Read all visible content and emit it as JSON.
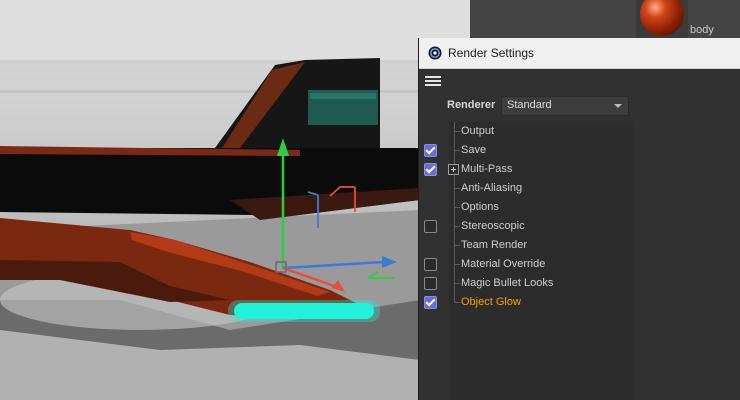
{
  "material_manager": {
    "material_name": "body"
  },
  "dialog": {
    "title": "Render Settings",
    "renderer_label": "Renderer",
    "renderer_value": "Standard",
    "items": [
      {
        "label": "Output",
        "checkbox": "none",
        "active": false
      },
      {
        "label": "Save",
        "checkbox": "checked",
        "active": false
      },
      {
        "label": "Multi-Pass",
        "checkbox": "checked",
        "expandable": true,
        "active": false
      },
      {
        "label": "Anti-Aliasing",
        "checkbox": "none",
        "active": false
      },
      {
        "label": "Options",
        "checkbox": "none",
        "active": false
      },
      {
        "label": "Stereoscopic",
        "checkbox": "unchecked",
        "active": false
      },
      {
        "label": "Team Render",
        "checkbox": "none",
        "active": false
      },
      {
        "label": "Material Override",
        "checkbox": "unchecked",
        "active": false
      },
      {
        "label": "Magic Bullet Looks",
        "checkbox": "unchecked",
        "active": false
      },
      {
        "label": "Object Glow",
        "checkbox": "checked",
        "active": true
      }
    ]
  },
  "colors": {
    "accent_active": "#f7a000",
    "checkbox_on": "#6a6fcf",
    "axis_y": "#2ecc40",
    "axis_x": "#e74c3c",
    "axis_z": "#3a7bd5",
    "glow": "#22f2d8"
  },
  "icons": [
    "cinema4d-app-icon",
    "hamburger-menu-icon",
    "dropdown-caret-icon",
    "tree-expander-plus-icon",
    "checkbox-icon"
  ]
}
